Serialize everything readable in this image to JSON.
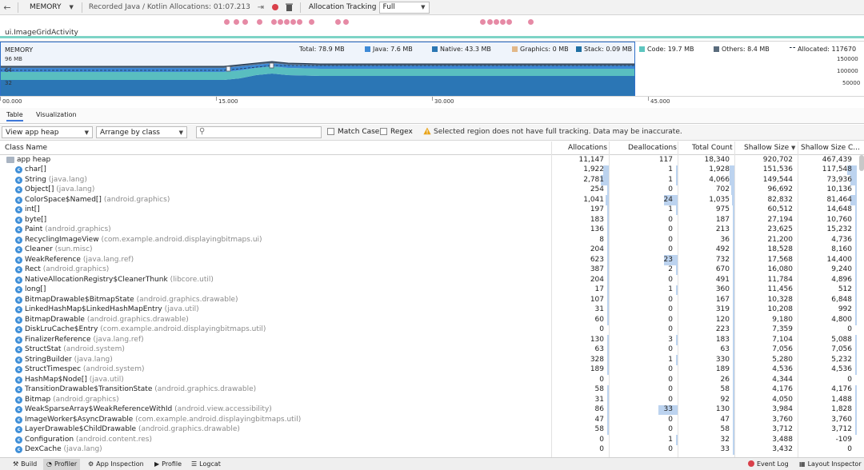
{
  "toolbar": {
    "session": "MEMORY",
    "recorded": "Recorded Java / Kotlin Allocations: 01:07.213",
    "tracking_label": "Allocation Tracking",
    "tracking_value": "Full"
  },
  "activity": {
    "name": "ui.ImageGridActivity"
  },
  "memory_chart": {
    "title": "MEMORY",
    "left_axis": [
      "96 MB",
      "64",
      "32"
    ],
    "right_axis": [
      "150000",
      "100000",
      "50000"
    ],
    "legend": {
      "total": "Total: 78.9 MB",
      "java": "Java: 7.6 MB",
      "native": "Native: 43.3 MB",
      "graphics": "Graphics: 0 MB",
      "stack": "Stack: 0.09 MB",
      "code": "Code: 19.7 MB",
      "others": "Others: 8.4 MB",
      "allocated": "Allocated: 117670"
    },
    "colors": {
      "java": "#3e8ad6",
      "native": "#2b77b3",
      "graphics": "#e2b889",
      "stack": "#1f6fa3",
      "code": "#5dc5bf",
      "others": "#5a6c7d",
      "selection": "#2f6fc9"
    }
  },
  "time_axis": [
    "00.000",
    "15.000",
    "30.000",
    "45.000"
  ],
  "tabs": [
    "Table",
    "Visualization"
  ],
  "filters": {
    "heap": "View app heap",
    "arrange": "Arrange by class",
    "search_placeholder": "",
    "match_case": "Match Case",
    "regex": "Regex",
    "warning": "Selected region does not have full tracking. Data may be inaccurate."
  },
  "table": {
    "columns": [
      "Class Name",
      "Allocations",
      "Deallocations",
      "Total Count",
      "Shallow Size",
      "Shallow Size C..."
    ],
    "root": {
      "name": "app heap",
      "allocations": "11,147",
      "deallocations": "117",
      "total": "18,340",
      "shallow": "920,702",
      "shallow_change": "467,439"
    },
    "rows": [
      {
        "name": "char[]",
        "pkg": "",
        "allocations": "1,922",
        "deallocations": "1",
        "total": "1,928",
        "shallow": "151,536",
        "shallow_change": "117,548"
      },
      {
        "name": "String",
        "pkg": "(java.lang)",
        "allocations": "2,781",
        "deallocations": "1",
        "total": "4,066",
        "shallow": "149,544",
        "shallow_change": "73,936"
      },
      {
        "name": "Object[]",
        "pkg": "(java.lang)",
        "allocations": "254",
        "deallocations": "0",
        "total": "702",
        "shallow": "96,692",
        "shallow_change": "10,136"
      },
      {
        "name": "ColorSpace$Named[]",
        "pkg": "(android.graphics)",
        "allocations": "1,041",
        "deallocations": "24",
        "total": "1,035",
        "shallow": "82,832",
        "shallow_change": "81,464"
      },
      {
        "name": "int[]",
        "pkg": "",
        "allocations": "197",
        "deallocations": "1",
        "total": "975",
        "shallow": "60,512",
        "shallow_change": "14,648"
      },
      {
        "name": "byte[]",
        "pkg": "",
        "allocations": "183",
        "deallocations": "0",
        "total": "187",
        "shallow": "27,194",
        "shallow_change": "10,760"
      },
      {
        "name": "Paint",
        "pkg": "(android.graphics)",
        "allocations": "136",
        "deallocations": "0",
        "total": "213",
        "shallow": "23,625",
        "shallow_change": "15,232"
      },
      {
        "name": "RecyclingImageView",
        "pkg": "(com.example.android.displayingbitmaps.ui)",
        "allocations": "8",
        "deallocations": "0",
        "total": "36",
        "shallow": "21,200",
        "shallow_change": "4,736"
      },
      {
        "name": "Cleaner",
        "pkg": "(sun.misc)",
        "allocations": "204",
        "deallocations": "0",
        "total": "492",
        "shallow": "18,528",
        "shallow_change": "8,160"
      },
      {
        "name": "WeakReference",
        "pkg": "(java.lang.ref)",
        "allocations": "623",
        "deallocations": "23",
        "total": "732",
        "shallow": "17,568",
        "shallow_change": "14,400"
      },
      {
        "name": "Rect",
        "pkg": "(android.graphics)",
        "allocations": "387",
        "deallocations": "2",
        "total": "670",
        "shallow": "16,080",
        "shallow_change": "9,240"
      },
      {
        "name": "NativeAllocationRegistry$CleanerThunk",
        "pkg": "(libcore.util)",
        "allocations": "204",
        "deallocations": "0",
        "total": "491",
        "shallow": "11,784",
        "shallow_change": "4,896"
      },
      {
        "name": "long[]",
        "pkg": "",
        "allocations": "17",
        "deallocations": "1",
        "total": "360",
        "shallow": "11,456",
        "shallow_change": "512"
      },
      {
        "name": "BitmapDrawable$BitmapState",
        "pkg": "(android.graphics.drawable)",
        "allocations": "107",
        "deallocations": "0",
        "total": "167",
        "shallow": "10,328",
        "shallow_change": "6,848"
      },
      {
        "name": "LinkedHashMap$LinkedHashMapEntry",
        "pkg": "(java.util)",
        "allocations": "31",
        "deallocations": "0",
        "total": "319",
        "shallow": "10,208",
        "shallow_change": "992"
      },
      {
        "name": "BitmapDrawable",
        "pkg": "(android.graphics.drawable)",
        "allocations": "60",
        "deallocations": "0",
        "total": "120",
        "shallow": "9,180",
        "shallow_change": "4,800"
      },
      {
        "name": "DiskLruCache$Entry",
        "pkg": "(com.example.android.displayingbitmaps.util)",
        "allocations": "0",
        "deallocations": "0",
        "total": "223",
        "shallow": "7,359",
        "shallow_change": "0"
      },
      {
        "name": "FinalizerReference",
        "pkg": "(java.lang.ref)",
        "allocations": "130",
        "deallocations": "3",
        "total": "183",
        "shallow": "7,104",
        "shallow_change": "5,088"
      },
      {
        "name": "StructStat",
        "pkg": "(android.system)",
        "allocations": "63",
        "deallocations": "0",
        "total": "63",
        "shallow": "7,056",
        "shallow_change": "7,056"
      },
      {
        "name": "StringBuilder",
        "pkg": "(java.lang)",
        "allocations": "328",
        "deallocations": "1",
        "total": "330",
        "shallow": "5,280",
        "shallow_change": "5,232"
      },
      {
        "name": "StructTimespec",
        "pkg": "(android.system)",
        "allocations": "189",
        "deallocations": "0",
        "total": "189",
        "shallow": "4,536",
        "shallow_change": "4,536"
      },
      {
        "name": "HashMap$Node[]",
        "pkg": "(java.util)",
        "allocations": "0",
        "deallocations": "0",
        "total": "26",
        "shallow": "4,344",
        "shallow_change": "0"
      },
      {
        "name": "TransitionDrawable$TransitionState",
        "pkg": "(android.graphics.drawable)",
        "allocations": "58",
        "deallocations": "0",
        "total": "58",
        "shallow": "4,176",
        "shallow_change": "4,176"
      },
      {
        "name": "Bitmap",
        "pkg": "(android.graphics)",
        "allocations": "31",
        "deallocations": "0",
        "total": "92",
        "shallow": "4,050",
        "shallow_change": "1,488"
      },
      {
        "name": "WeakSparseArray$WeakReferenceWithId",
        "pkg": "(android.view.accessibility)",
        "allocations": "86",
        "deallocations": "33",
        "total": "130",
        "shallow": "3,984",
        "shallow_change": "1,828"
      },
      {
        "name": "ImageWorker$AsyncDrawable",
        "pkg": "(com.example.android.displayingbitmaps.util)",
        "allocations": "47",
        "deallocations": "0",
        "total": "47",
        "shallow": "3,760",
        "shallow_change": "3,760"
      },
      {
        "name": "LayerDrawable$ChildDrawable",
        "pkg": "(android.graphics.drawable)",
        "allocations": "58",
        "deallocations": "0",
        "total": "58",
        "shallow": "3,712",
        "shallow_change": "3,712"
      },
      {
        "name": "Configuration",
        "pkg": "(android.content.res)",
        "allocations": "0",
        "deallocations": "1",
        "total": "32",
        "shallow": "3,488",
        "shallow_change": "-109"
      },
      {
        "name": "DexCache",
        "pkg": "(java.lang)",
        "allocations": "0",
        "deallocations": "0",
        "total": "33",
        "shallow": "3,432",
        "shallow_change": "0"
      }
    ]
  },
  "bottom_bar": {
    "build": "Build",
    "profiler": "Profiler",
    "app_inspection": "App Inspection",
    "profile": "Profile",
    "logcat": "Logcat",
    "event_log": "Event Log",
    "layout_inspector": "Layout Inspector"
  }
}
